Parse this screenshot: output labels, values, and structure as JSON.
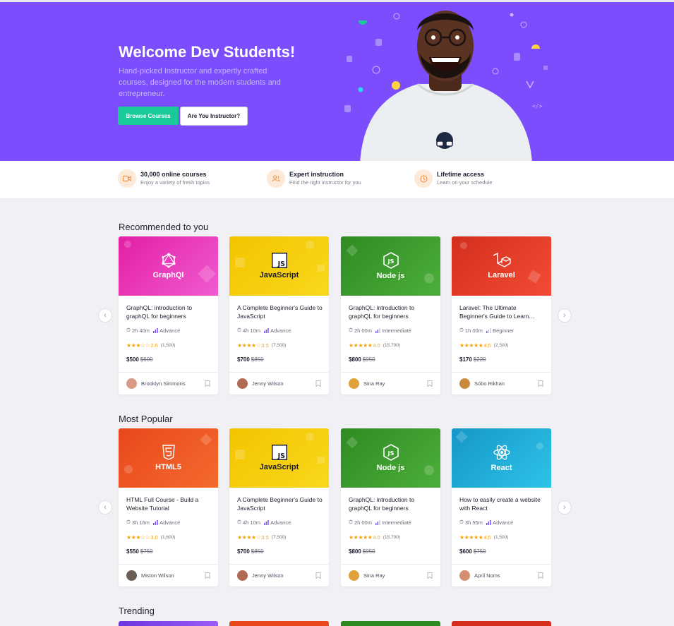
{
  "hero": {
    "title": "Welcome Dev Students!",
    "subtitle": "Hand-picked Instructor and expertly crafted courses, designed for the modern students and entrepreneur.",
    "browse_label": "Browse Courses",
    "instructor_label": "Are You Instructor?"
  },
  "features": [
    {
      "title": "30,000 online courses",
      "desc": "Enjoy a variety of fresh topics",
      "icon": "video-icon"
    },
    {
      "title": "Expert instruction",
      "desc": "Find the right instructor for you",
      "icon": "users-icon"
    },
    {
      "title": "Lifetime access",
      "desc": "Learn on your schedule",
      "icon": "clock-icon"
    }
  ],
  "sections": {
    "recommended": {
      "title": "Recommended to you",
      "cards": [
        {
          "tech": "GraphQl",
          "title": "GraphQL: introduction to graphQL for beginners",
          "duration": "2h 40m",
          "level": "Advance",
          "stars": "★★★☆☆",
          "rating": "2.5",
          "reviews": "(1,500)",
          "price": "$500",
          "old_price": "$600",
          "author": "Brooklyn Simmons"
        },
        {
          "tech": "JavaScript",
          "title": "A Complete Beginner's Guide to JavaScript",
          "duration": "4h 10m",
          "level": "Advance",
          "stars": "★★★★☆",
          "rating": "3.5",
          "reviews": "(7,500)",
          "price": "$700",
          "old_price": "$850",
          "author": "Jenny Wilson"
        },
        {
          "tech": "Node js",
          "title": "GraphQL: introduction to graphQL for beginners",
          "duration": "2h 00m",
          "level": "Intermediate",
          "stars": "★★★★★",
          "rating": "4.0",
          "reviews": "(15,700)",
          "price": "$800",
          "old_price": "$950",
          "author": "Sina Ray"
        },
        {
          "tech": "Laravel",
          "title": "Laravel: The Ultimate Beginner's Guide to Learn...",
          "duration": "1h 00m",
          "level": "Beginner",
          "stars": "★★★★★",
          "rating": "4.5",
          "reviews": "(2,500)",
          "price": "$170",
          "old_price": "$220",
          "author": "Sobo Rikhan"
        }
      ]
    },
    "popular": {
      "title": "Most Popular",
      "cards": [
        {
          "tech": "HTML5",
          "title": "HTML Full Course - Build a Website Tutorial",
          "duration": "3h 16m",
          "level": "Advance",
          "stars": "★★★☆☆",
          "rating": "3.0",
          "reviews": "(1,600)",
          "price": "$550",
          "old_price": "$750",
          "author": "Miston Wilson"
        },
        {
          "tech": "JavaScript",
          "title": "A Complete Beginner's Guide to JavaScript",
          "duration": "4h 10m",
          "level": "Advance",
          "stars": "★★★★☆",
          "rating": "3.5",
          "reviews": "(7,500)",
          "price": "$700",
          "old_price": "$850",
          "author": "Jenny Wilson"
        },
        {
          "tech": "Node js",
          "title": "GraphQL: introduction to graphQL for beginners",
          "duration": "2h 00m",
          "level": "Intermediate",
          "stars": "★★★★★",
          "rating": "4.0",
          "reviews": "(15,700)",
          "price": "$800",
          "old_price": "$950",
          "author": "Sina Ray"
        },
        {
          "tech": "React",
          "title": "How to easily create a website with React",
          "duration": "3h 55m",
          "level": "Advance",
          "stars": "★★★★★",
          "rating": "4.5",
          "reviews": "(1,500)",
          "price": "$600",
          "old_price": "$750",
          "author": "April Noms"
        }
      ]
    },
    "trending": {
      "title": "Trending"
    }
  },
  "colors": {
    "hero": "#7b4dfd",
    "accent": "#19c99a",
    "star": "#f4a30b"
  }
}
